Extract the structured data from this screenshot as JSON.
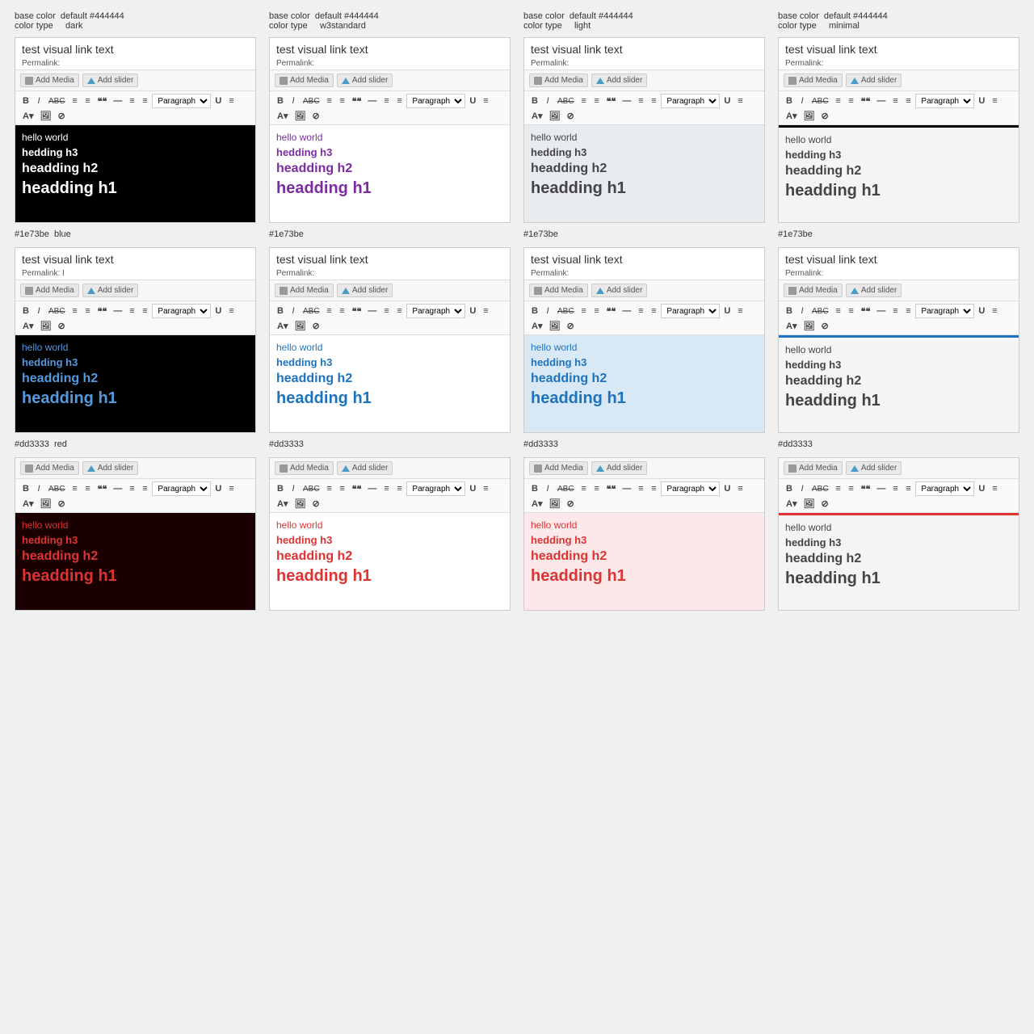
{
  "columns": [
    "dark",
    "w3standard",
    "light",
    "minimal"
  ],
  "rows": [
    {
      "baseColor": "#444444",
      "colorName": "default",
      "accentColor": null,
      "accentName": null,
      "themes": [
        "dark",
        "w3standard",
        "light",
        "minimal"
      ]
    },
    {
      "baseColor": "#1e73be",
      "colorName": "blue",
      "accentColor": "#1e73be",
      "accentName": null,
      "themes": [
        "dark",
        "w3standard",
        "light",
        "minimal"
      ]
    },
    {
      "baseColor": "#dd3333",
      "colorName": "red",
      "accentColor": "#dd3333",
      "accentName": null,
      "themes": [
        "dark",
        "w3standard",
        "light",
        "minimal"
      ]
    }
  ],
  "editor": {
    "title": "test visual link text",
    "permalink_label": "Permalink:",
    "add_media": "Add Media",
    "add_slider": "Add slider",
    "format_buttons": [
      "B",
      "I",
      "ABC",
      "≡",
      "≡",
      "❝❝",
      "—",
      "≡",
      "≡"
    ],
    "paragraph_label": "Paragraph",
    "content": {
      "p": "hello world",
      "h3": "hedding h3",
      "h2": "headding h2",
      "h1": "headding h1"
    }
  },
  "meta": {
    "base_color_key": "base color",
    "color_type_key": "color type",
    "default_label": "default #444444",
    "dark_label": "dark",
    "w3standard_label": "w3standard",
    "light_label": "light",
    "minimal_label": "minimal",
    "blue_base": "#1e73be",
    "blue_color": "blue",
    "red_base": "#dd3333",
    "red_color": "red"
  }
}
